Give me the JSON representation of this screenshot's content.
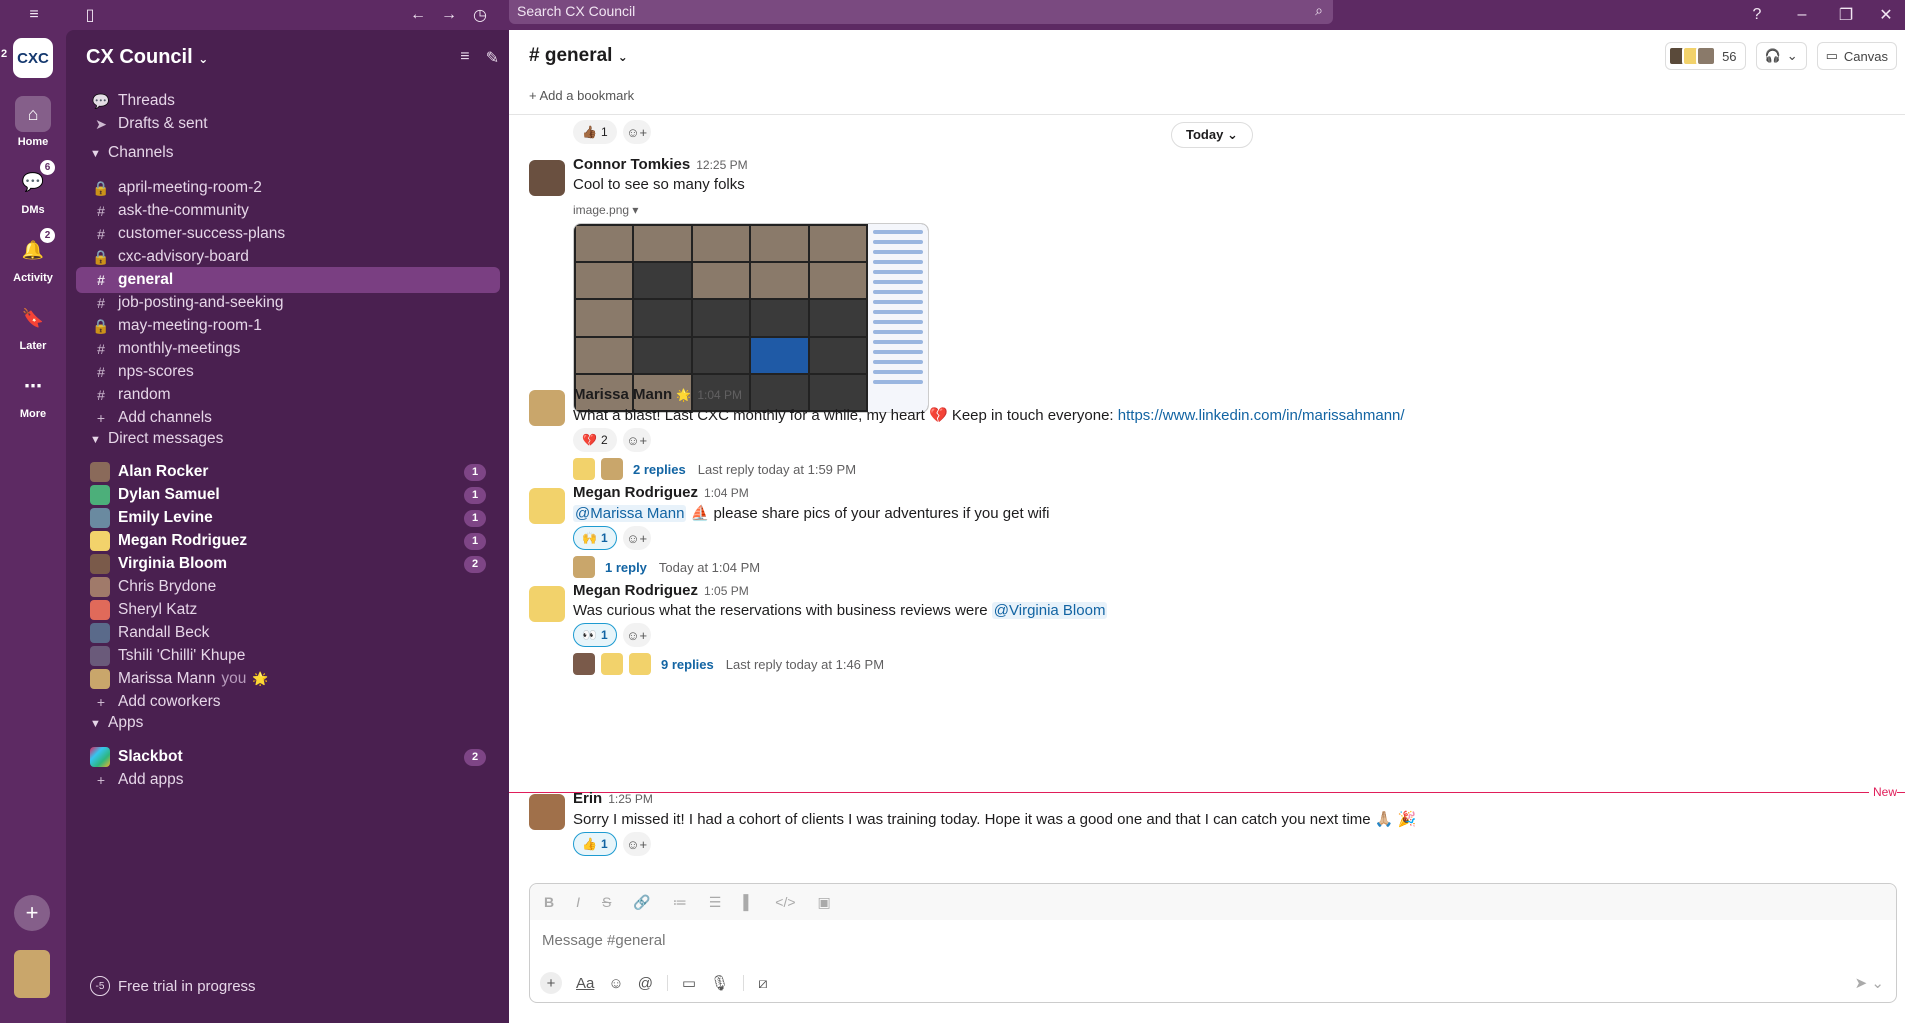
{
  "search": {
    "placeholder": "Search CX Council"
  },
  "workspace": {
    "name": "CX Council",
    "logo_text": "CXC",
    "logo_badge": "2"
  },
  "rail": [
    {
      "label": "Home",
      "badge": ""
    },
    {
      "label": "DMs",
      "badge": "6"
    },
    {
      "label": "Activity",
      "badge": "2"
    },
    {
      "label": "Later",
      "badge": ""
    },
    {
      "label": "More",
      "badge": ""
    }
  ],
  "sidebar": {
    "top_items": [
      {
        "label": "Threads"
      },
      {
        "label": "Drafts & sent"
      }
    ],
    "channels_title": "Channels",
    "channels": [
      {
        "name": "april-meeting-room-2",
        "private": true
      },
      {
        "name": "ask-the-community",
        "private": false
      },
      {
        "name": "customer-success-plans",
        "private": false
      },
      {
        "name": "cxc-advisory-board",
        "private": true
      },
      {
        "name": "general",
        "private": false,
        "active": true
      },
      {
        "name": "job-posting-and-seeking",
        "private": false
      },
      {
        "name": "may-meeting-room-1",
        "private": true
      },
      {
        "name": "monthly-meetings",
        "private": false
      },
      {
        "name": "nps-scores",
        "private": false
      },
      {
        "name": "random",
        "private": false
      }
    ],
    "add_channels": "Add channels",
    "dms_title": "Direct messages",
    "dms": [
      {
        "name": "Alan Rocker",
        "count": "1",
        "unread": true,
        "color": "#8a6a5a"
      },
      {
        "name": "Dylan Samuel",
        "count": "1",
        "unread": true,
        "color": "#4caf7a"
      },
      {
        "name": "Emily Levine",
        "count": "1",
        "unread": true,
        "color": "#6a8aa0"
      },
      {
        "name": "Megan Rodriguez",
        "count": "1",
        "unread": true,
        "color": "#f2d26b"
      },
      {
        "name": "Virginia Bloom",
        "count": "2",
        "unread": true,
        "color": "#7a5a4a"
      },
      {
        "name": "Chris Brydone",
        "count": "",
        "unread": false,
        "color": "#a07a6a"
      },
      {
        "name": "Sheryl Katz",
        "count": "",
        "unread": false,
        "color": "#e06a5a"
      },
      {
        "name": "Randall Beck",
        "count": "",
        "unread": false,
        "color": "#5a6a8a"
      },
      {
        "name": "Tshili 'Chilli' Khupe",
        "count": "",
        "unread": false,
        "color": "#6a5a7a"
      },
      {
        "name": "Marissa Mann",
        "count": "",
        "unread": false,
        "color": "#c9a66b",
        "you": "you",
        "emoji": "🌟"
      }
    ],
    "add_coworkers": "Add coworkers",
    "apps_title": "Apps",
    "apps": [
      {
        "name": "Slackbot",
        "count": "2"
      }
    ],
    "add_apps": "Add apps",
    "free_trial": "Free trial in progress",
    "free_trial_icon": "-5"
  },
  "channel": {
    "title": "# general",
    "member_count": "56",
    "canvas_label": "Canvas",
    "bookmark": "Add a bookmark",
    "date_pill": "Today"
  },
  "messages": {
    "top_reaction": {
      "emoji": "👍🏾",
      "count": "1"
    },
    "m1": {
      "author": "Connor Tomkies",
      "time": "12:25 PM",
      "text": "Cool to see so many folks",
      "file": "image.png"
    },
    "m2": {
      "author": "Marissa Mann",
      "emoji": "🌟",
      "time": "1:04 PM",
      "text": "What a blast! Last CXC monthly for a while, my heart 💔 Keep in touch everyone:",
      "link": "https://www.linkedin.com/in/marissahmann/",
      "reaction": {
        "emoji": "💔",
        "count": "2"
      },
      "replies": "2 replies",
      "last_reply": "Last reply today at 1:59 PM"
    },
    "m3": {
      "author": "Megan Rodriguez",
      "time": "1:04 PM",
      "mention": "@Marissa Mann",
      "text": "⛵ please share pics of your adventures if you get wifi",
      "reaction": {
        "emoji": "🙌",
        "count": "1"
      },
      "replies": "1 reply",
      "last_reply": "Today at 1:04 PM"
    },
    "m4": {
      "author": "Megan Rodriguez",
      "time": "1:05 PM",
      "text": "Was curious what the reservations with business reviews were",
      "mention": "@Virginia Bloom",
      "reaction": {
        "emoji": "👀",
        "count": "1"
      },
      "replies": "9 replies",
      "last_reply": "Last reply today at 1:46 PM"
    },
    "m5": {
      "author": "Erin",
      "time": "1:25 PM",
      "text": "Sorry I missed it! I had a cohort of clients I was training today. Hope it was a good one and that I can catch you next time 🙏🏼 🎉",
      "reaction": {
        "emoji": "👍",
        "count": "1"
      }
    }
  },
  "new_label": "New",
  "composer": {
    "placeholder": "Message #general",
    "format_label": "Aa"
  }
}
